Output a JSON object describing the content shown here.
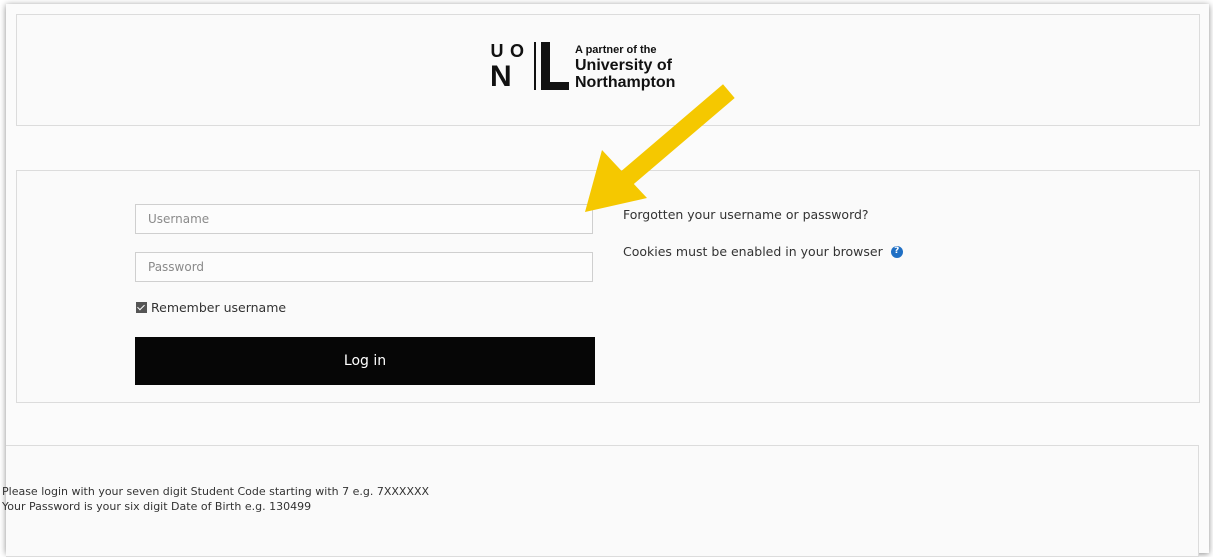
{
  "header": {
    "logo": {
      "mark_top_left": "U",
      "mark_top_right": "O",
      "mark_bottom": "N",
      "tagline": "A partner of the",
      "name_line1": "University of",
      "name_line2": "Northampton"
    }
  },
  "login": {
    "username_placeholder": "Username",
    "password_placeholder": "Password",
    "remember_label": "Remember username",
    "remember_checked": true,
    "login_button_label": "Log in",
    "forgot_link": "Forgotten your username or password?",
    "cookies_text": "Cookies must be enabled in your browser"
  },
  "notice": {
    "line1": "Please login with your seven digit Student Code starting with 7 e.g. 7XXXXXX",
    "line2": "Your Password is your six digit Date of Birth e.g. 130499"
  },
  "annotation": {
    "arrow_color": "#f5c800"
  }
}
